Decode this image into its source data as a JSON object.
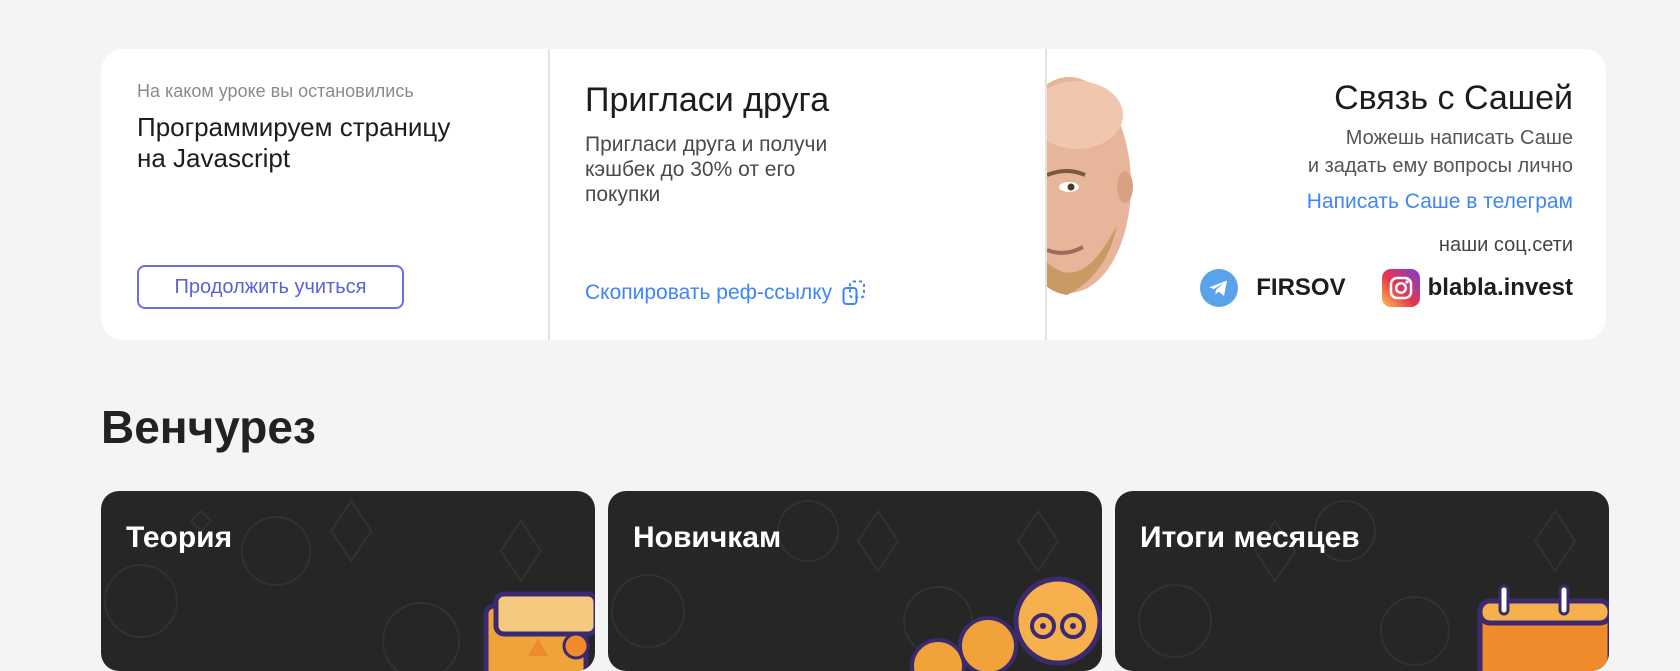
{
  "lesson": {
    "hint": "На каком уроке вы остановились",
    "title": "Программируем страницу на Javascript",
    "continue_label": "Продолжить  учиться"
  },
  "invite": {
    "title": "Пригласи друга",
    "text": "Пригласи друга и получи кэшбек до 30% от его покупки",
    "copy_label": "Скопировать реф-ссылку"
  },
  "contact": {
    "title": "Связь с Сашей",
    "text_line1": "Можешь написать Саше",
    "text_line2": "и задать ему вопросы лично",
    "telegram_link": "Написать Саше в телеграм",
    "socials_label": "наши соц.сети",
    "socials": [
      {
        "icon": "telegram-icon",
        "name": "FIRSOV"
      },
      {
        "icon": "instagram-icon",
        "name": "blabla.invest"
      }
    ]
  },
  "section": {
    "title": "Венчурез"
  },
  "courses": [
    {
      "title": "Теория",
      "icon": "book-illustration"
    },
    {
      "title": "Новичкам",
      "icon": "people-illustration"
    },
    {
      "title": "Итоги месяцев",
      "icon": "calendar-illustration"
    }
  ],
  "colors": {
    "accent_blue": "#3f85f5",
    "button_purple": "#6a6fe6",
    "card_dark": "#262626",
    "page_bg": "#f4f4f4"
  }
}
